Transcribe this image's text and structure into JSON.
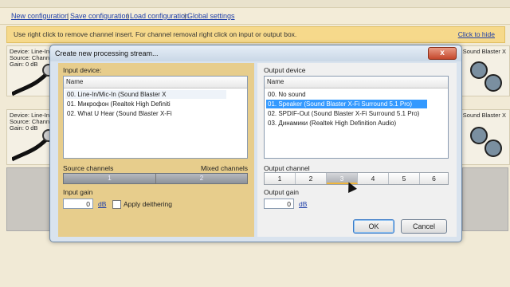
{
  "menu": {
    "links": [
      "New configuration",
      "Save configuration",
      "Load configuration",
      "Global settings"
    ],
    "sep": "|"
  },
  "infobar": {
    "message": "Use right click to remove channel insert. For channel removal right click on input or output box.",
    "hide_link": "Click to hide"
  },
  "background_rows": [
    {
      "lines": [
        "Device: Line-In/",
        "Source: Channe",
        "Gain: 0 dB"
      ],
      "right": "Sound Blaster X"
    },
    {
      "lines": [
        "Device: Line-In/",
        "Source: Channe",
        "Gain: 0 dB"
      ],
      "right": "Sound Blaster X"
    }
  ],
  "dialog": {
    "title": "Create new processing stream...",
    "close_glyph": "x",
    "input": {
      "label": "Input device:",
      "column_header": "Name",
      "items": [
        "00. Line-In/Mic-In (Sound Blaster X",
        "01. Микрофон (Realtek High Definiti",
        "02. What U Hear (Sound Blaster X-Fi"
      ],
      "highlighted_index": 0,
      "source_channels_label": "Source channels",
      "mixed_channels_label": "Mixed channels",
      "channels": [
        "1",
        "2"
      ],
      "gain_label": "Input gain",
      "gain_value": "0",
      "gain_unit": "dB",
      "dither_label": "Apply deithering",
      "dither_checked": false
    },
    "output": {
      "label": "Output device",
      "column_header": "Name",
      "items": [
        "00. No sound",
        "01. Speaker (Sound Blaster X-Fi Surround 5.1 Pro)",
        "02. SPDIF-Out (Sound Blaster X-Fi Surround 5.1 Pro)",
        "03. Динамики (Realtek High Definition Audio)"
      ],
      "selected_index": 1,
      "channel_label": "Output channel",
      "channels": [
        "1",
        "2",
        "3",
        "4",
        "5",
        "6"
      ],
      "active_channel_index": 2,
      "gain_label": "Output gain",
      "gain_value": "0",
      "gain_unit": "dB"
    },
    "buttons": {
      "ok": "OK",
      "cancel": "Cancel"
    }
  },
  "colors": {
    "input_pane": "#e7cd8c",
    "selection": "#3399ff",
    "infobar": "#f6d98b",
    "link": "#1f3fa8"
  }
}
